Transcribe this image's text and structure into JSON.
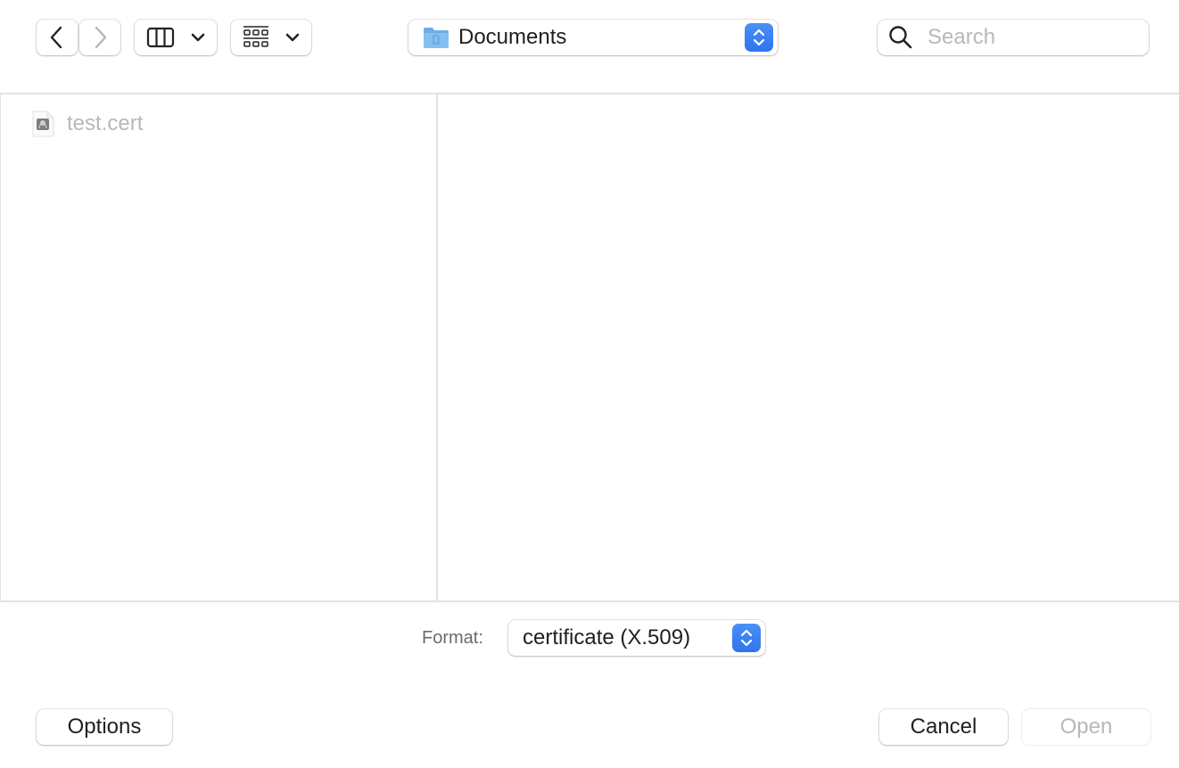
{
  "toolbar": {
    "back_icon": "chevron-left-icon",
    "forward_icon": "chevron-right-icon",
    "view_mode_icon": "column-view-icon",
    "group_icon": "grid-group-icon",
    "location": {
      "label": "Documents",
      "icon": "folder-icon"
    },
    "search": {
      "placeholder": "Search",
      "value": ""
    }
  },
  "files": [
    {
      "name": "test.cert",
      "icon": "certificate-file-icon",
      "enabled": false
    }
  ],
  "format": {
    "label": "Format:",
    "selected": "certificate (X.509)"
  },
  "buttons": {
    "options": "Options",
    "cancel": "Cancel",
    "open": "Open"
  },
  "colors": {
    "accent": "#3b82f6",
    "disabled_text": "#b8b8b8",
    "divider": "#e3e3e3"
  }
}
